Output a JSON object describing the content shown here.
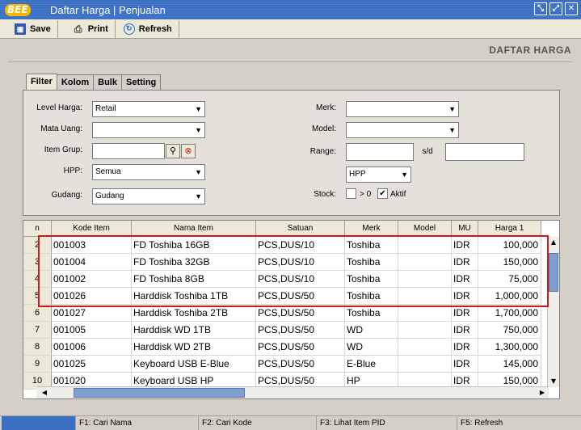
{
  "window": {
    "logo_text": "BEE",
    "title": "Daftar Harga | Penjualan"
  },
  "toolbar": {
    "save": "Save",
    "print": "Print",
    "refresh": "Refresh"
  },
  "page_title": "DAFTAR HARGA",
  "tabs": [
    "Filter",
    "Kolom",
    "Bulk",
    "Setting"
  ],
  "filter": {
    "level_harga_label": "Level Harga:",
    "level_harga_value": "Retail",
    "mata_uang_label": "Mata Uang:",
    "mata_uang_value": "",
    "item_grup_label": "Item Grup:",
    "hpp_label": "HPP:",
    "hpp_value": "Semua",
    "gudang_label": "Gudang:",
    "gudang_value": "Gudang",
    "merk_label": "Merk:",
    "merk_value": "",
    "model_label": "Model:",
    "model_value": "",
    "range_label": "Range:",
    "range_sep": "s/d",
    "range_type_value": "HPP",
    "stock_label": "Stock:",
    "stock_gt0_label": "> 0",
    "stock_aktif_label": "Aktif"
  },
  "grid": {
    "columns": [
      "n",
      "Kode Item",
      "Nama Item",
      "Satuan",
      "Merk",
      "Model",
      "MU",
      "Harga 1"
    ],
    "rows": [
      [
        "2",
        "001003",
        "FD Toshiba 16GB",
        "PCS,DUS/10",
        "Toshiba",
        "",
        "IDR",
        "100,000"
      ],
      [
        "3",
        "001004",
        "FD Toshiba 32GB",
        "PCS,DUS/10",
        "Toshiba",
        "",
        "IDR",
        "150,000"
      ],
      [
        "4",
        "001002",
        "FD Toshiba 8GB",
        "PCS,DUS/10",
        "Toshiba",
        "",
        "IDR",
        "75,000"
      ],
      [
        "5",
        "001026",
        "Harddisk Toshiba 1TB",
        "PCS,DUS/50",
        "Toshiba",
        "",
        "IDR",
        "1,000,000"
      ],
      [
        "6",
        "001027",
        "Harddisk Toshiba 2TB",
        "PCS,DUS/50",
        "Toshiba",
        "",
        "IDR",
        "1,700,000"
      ],
      [
        "7",
        "001005",
        "Harddisk WD 1TB",
        "PCS,DUS/50",
        "WD",
        "",
        "IDR",
        "750,000"
      ],
      [
        "8",
        "001006",
        "Harddisk WD 2TB",
        "PCS,DUS/50",
        "WD",
        "",
        "IDR",
        "1,300,000"
      ],
      [
        "9",
        "001025",
        "Keyboard USB E-Blue",
        "PCS,DUS/50",
        "E-Blue",
        "",
        "IDR",
        "145,000"
      ],
      [
        "10",
        "001020",
        "Keyboard USB HP",
        "PCS,DUS/50",
        "HP",
        "",
        "IDR",
        "150,000"
      ]
    ]
  },
  "statusbar": [
    "F1: Cari Nama",
    "F2: Cari Kode",
    "F3: Lihat Item PID",
    "F5: Refresh"
  ]
}
